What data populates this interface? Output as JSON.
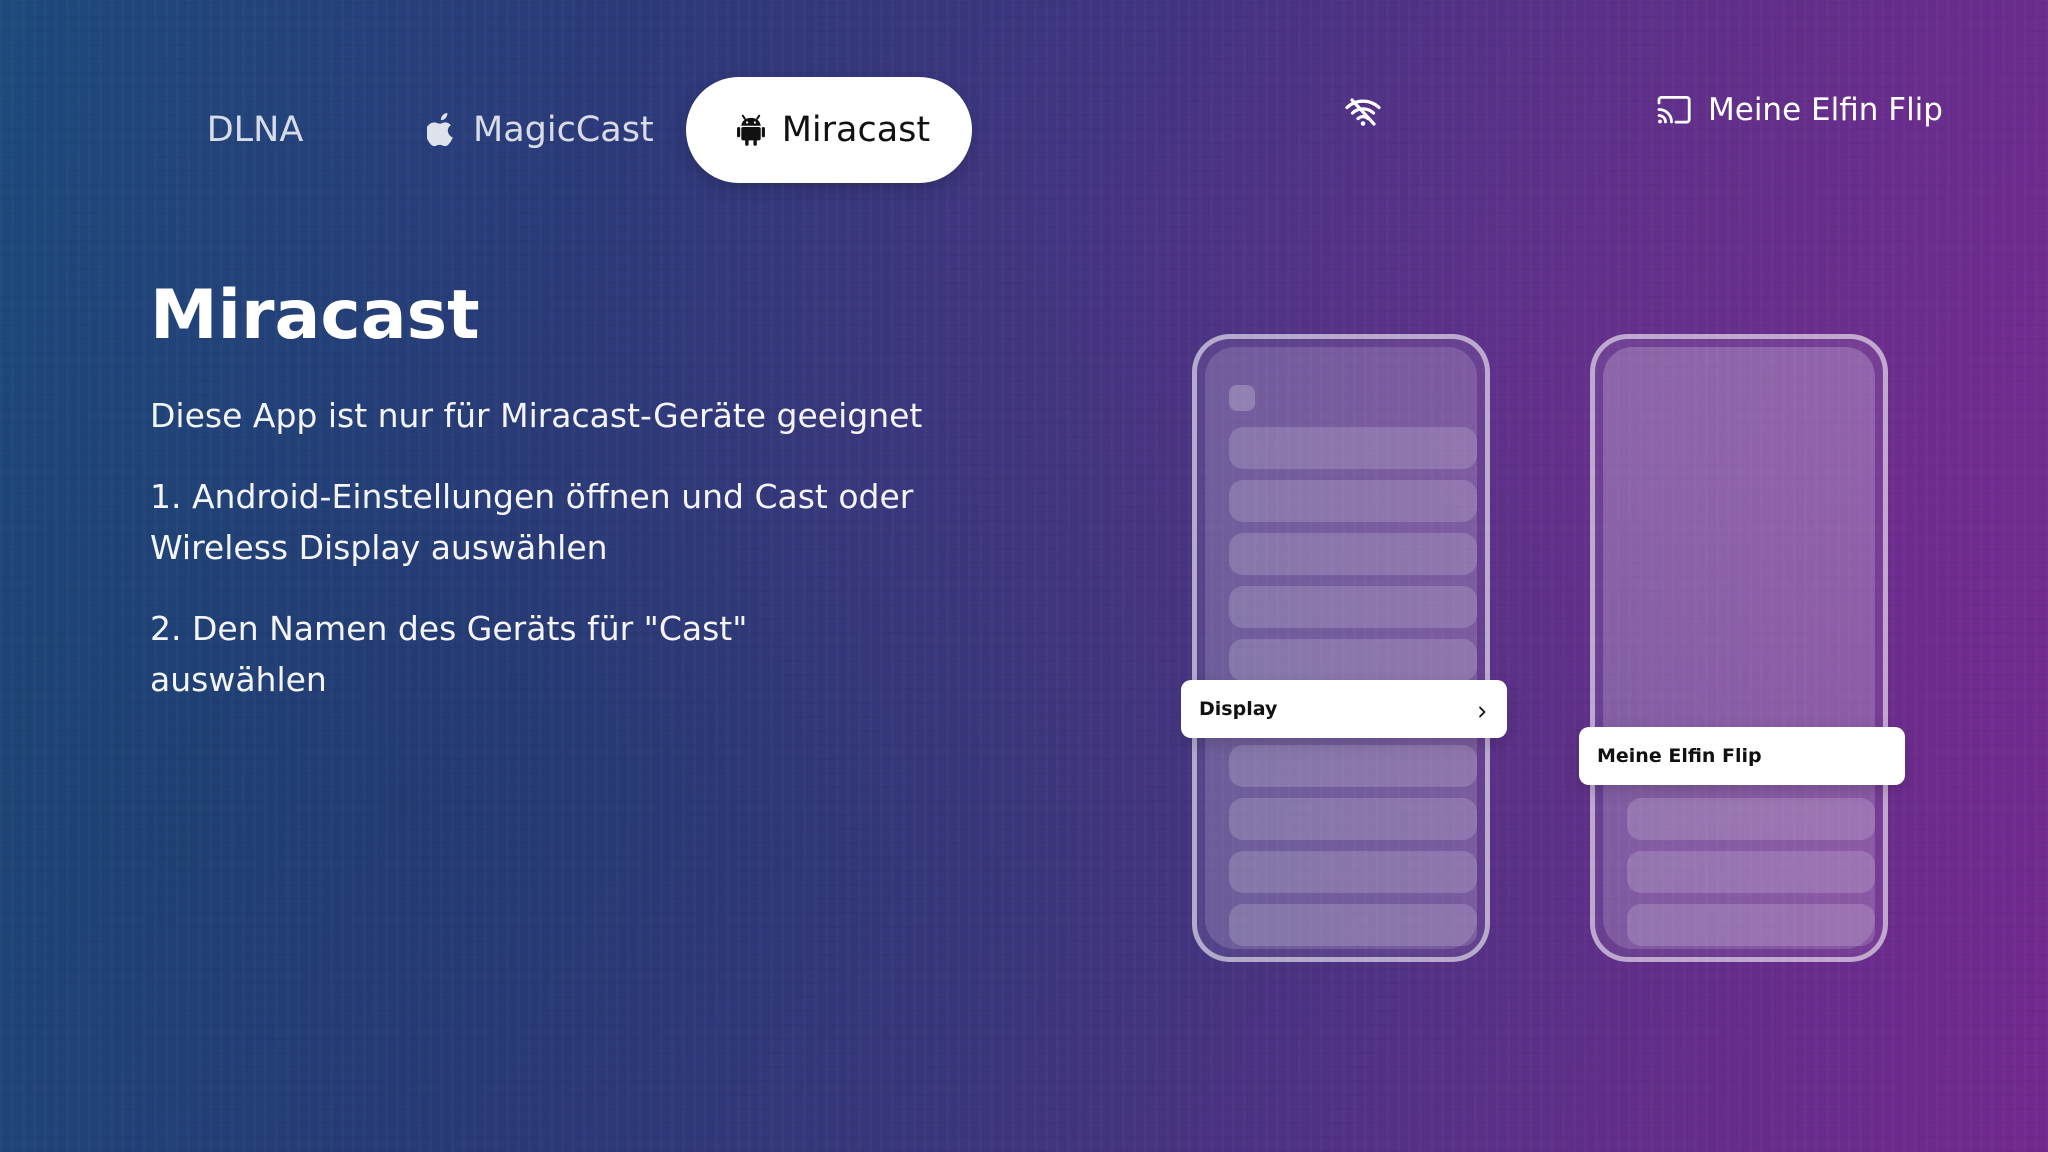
{
  "tabs": [
    {
      "label": "DLNA",
      "icon": "none",
      "selected": false
    },
    {
      "label": "MagicCast",
      "icon": "apple-icon",
      "selected": false
    },
    {
      "label": "Miracast",
      "icon": "android-icon",
      "selected": true
    }
  ],
  "status": {
    "wifi_icon": "wifi-off-icon",
    "cast_icon": "cast-icon",
    "device_name": "Meine Elfin Flip"
  },
  "content": {
    "title": "Miracast",
    "subtitle": "Diese App ist nur für Miracast-Geräte geeignet",
    "step1_line1": "1. Android-Einstellungen öffnen und Cast oder",
    "step1_line2": "Wireless Display auswählen",
    "step2": "2. Den Namen des Geräts für \"Cast\" auswählen"
  },
  "illustration": {
    "phone1_popup": "Display",
    "phone2_popup": "Meine Elfin Flip"
  },
  "colors": {
    "gradient_start": "#1d4a7c",
    "gradient_end": "#72298e",
    "selected_tab_bg": "#ffffff"
  }
}
